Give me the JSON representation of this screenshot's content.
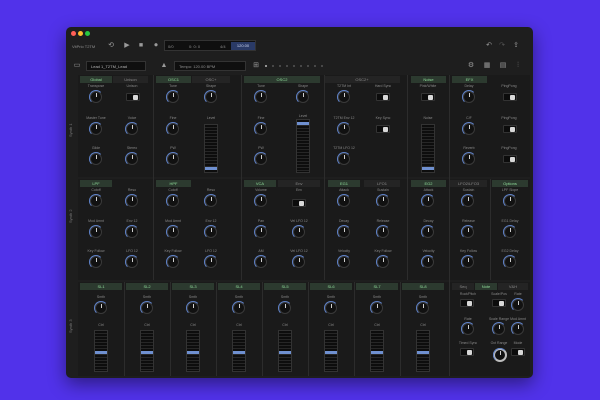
{
  "toolbar": {
    "app_name": "VitPrio T2TM",
    "position": "0: 0: 0",
    "time_sig_label": "4/4",
    "beat_label": "4",
    "tempo_display": "120.00",
    "preset_name": "Lead 1_T2TM_Lead",
    "tempo_field": "Tempo: 120.00 BPM"
  },
  "row_labels": [
    "Synth 1",
    "Synth 2",
    "Synth 3"
  ],
  "row1": {
    "tabs": [
      "Global",
      "Unison",
      "OSC1",
      "OSC+",
      "OSC2",
      "OSC2+",
      "Noise",
      "EFX"
    ],
    "knobs": {
      "transpose": "Transpose",
      "master_tune": "Master Tune",
      "glide": "Glide",
      "unison": "Unison",
      "voice": "Voice",
      "stereo": "Stereo",
      "osc1_tune": "Tune",
      "osc1_fine": "Fine",
      "osc1_pw": "PW",
      "osc1_shape": "Shape",
      "osc1_level": "Level",
      "osc2_tune": "Tune",
      "osc2_fine": "Fine",
      "osc2_pw": "PW",
      "osc2_shape": "Shape",
      "osc2_level": "Level",
      "t2tm_int": "T2TM Int",
      "t2tm_env": "T2TM Env 12",
      "t2tm_lfo": "T2TM LFO 12",
      "hard_sync": "Hard Sync",
      "key_sync": "Key Sync",
      "pink_white": "Pink/White",
      "noise": "Noise",
      "delay": "Delay",
      "cf": "C/F",
      "reverb": "Reverb",
      "pingpong1": "PingPong",
      "pingpong2": "PingPong",
      "pingpong3": "PingPong"
    }
  },
  "row2": {
    "tabs": [
      "LPF",
      "HPF",
      "VCA",
      "Env",
      "EG1",
      "LFO1",
      "EG2",
      "LFO2/LFO3",
      "Options"
    ],
    "knobs": {
      "lpf_cutoff": "Cutoff",
      "lpf_mod": "Mod Amnt",
      "lpf_keyf": "Key Follow",
      "lpf_reso": "Reso",
      "lpf_env": "Env 12",
      "lpf_lfo": "LFO 12",
      "hpf_cutoff": "Cutoff",
      "hpf_mod": "Mod Amnt",
      "hpf_keyf": "Key Follow",
      "hpf_reso": "Reso",
      "hpf_env": "Env 12",
      "hpf_lfo": "LFO 12",
      "vca_volume": "Volume",
      "vca_pan": "Pan",
      "vca_am": "AM",
      "env": "Env",
      "vca_lfo": "Vel LFO 12",
      "vca_lfo2": "Vel LFO 12",
      "eg1_attack": "Attack",
      "eg1_decay": "Decay",
      "eg1_vel": "Velocity",
      "eg1_sustain": "Sustain",
      "eg1_release": "Release",
      "eg1_keyf": "Key Follow",
      "eg2_attack": "Attack",
      "eg2_decay": "Decay",
      "eg2_vel": "Velocity",
      "eg2_sustain": "Sustain",
      "eg2_release": "Release",
      "eg2_keyf": "Key Follow",
      "lpf_slope": "LPF Slope",
      "eg1_delay": "EG1 Delay",
      "eg2_delay": "EG2 Delay"
    }
  },
  "row3": {
    "sliders": [
      "SL1",
      "SL2",
      "SL3",
      "SL4",
      "SL5",
      "SL6",
      "SL7",
      "SL8"
    ],
    "sub_a": "Smth",
    "sub_b": "Ctrl",
    "tabs": [
      "Seq",
      "Note",
      "V&H"
    ],
    "knobs": {
      "root_pitch": "Root/Pitch",
      "scale_pos": "Scale/Pos",
      "rate": "Rate",
      "gate": "Gate",
      "swing": "Swing",
      "timed_sync": "Timed Sync",
      "scale_range": "Scale Range",
      "oct_range": "Oct Range",
      "rate2": "Rate",
      "mod_amnt": "Mod Amnt",
      "mode": "Mode"
    }
  },
  "colors": {
    "accent": "#6f90d0",
    "active_tab": "#8fdc9a",
    "window_bg": "#1e1e1e",
    "desktop": "#5132ea"
  }
}
